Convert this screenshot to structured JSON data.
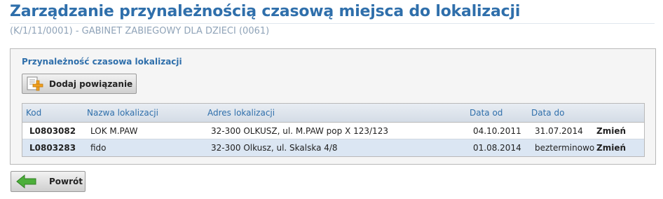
{
  "header": {
    "title": "Zarządzanie przynależnością czasową miejsca do lokalizacji",
    "subtitle": "(K/1/11/0001) - GABINET ZABIEGOWY DLA DZIECI (0061)"
  },
  "section": {
    "label": "Przynależność czasowa lokalizacji",
    "add_button": {
      "label": "Dodaj powiązanie",
      "icon": "add-document-icon"
    }
  },
  "table": {
    "columns": [
      "Kod",
      "Nazwa lokalizacji",
      "Adres lokalizacji",
      "Data od",
      "Data do"
    ],
    "rows": [
      {
        "kod": "L0803082",
        "nazwa": "LOK M.PAW",
        "adres": "32-300 OLKUSZ, ul. M.PAW pop X 123/123",
        "data_od": "04.10.2011",
        "data_do": "31.07.2014",
        "action": "Zmień"
      },
      {
        "kod": "L0803283",
        "nazwa": "fido",
        "adres": "32-300 Olkusz, ul. Skalska 4/8",
        "data_od": "01.08.2014",
        "data_do": "bezterminowo",
        "action": "Zmień"
      }
    ]
  },
  "footer": {
    "back_button": {
      "label": "Powrót",
      "icon": "arrow-left-icon"
    }
  },
  "colors": {
    "accent": "#2f6fab",
    "subtitle": "#8fa3b8",
    "row_alt": "#dbe6f3",
    "arrow_green": "#4caf3a",
    "plus_orange": "#f0a020"
  }
}
